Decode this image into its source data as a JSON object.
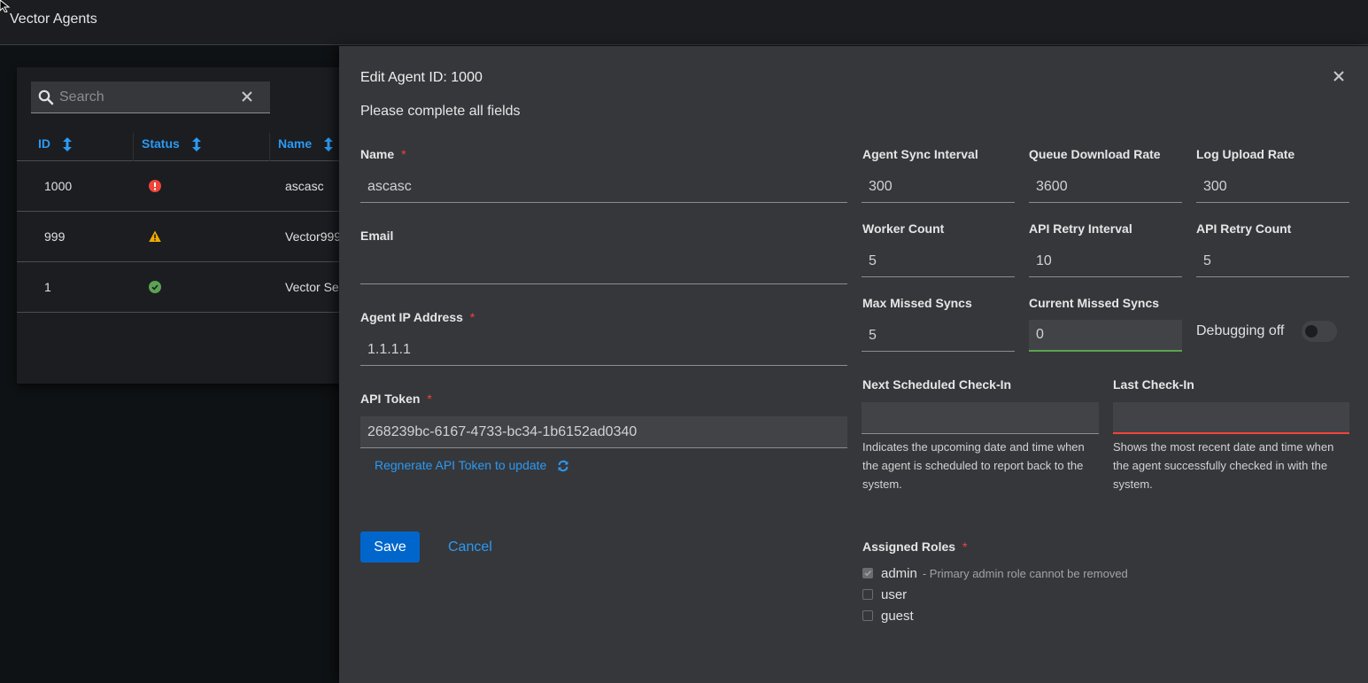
{
  "app": {
    "title": "Vector Agents"
  },
  "table": {
    "search": {
      "placeholder": "Search",
      "value": ""
    },
    "columns": [
      {
        "label": "ID"
      },
      {
        "label": "Status"
      },
      {
        "label": "Name"
      }
    ],
    "rows": [
      {
        "id": "1000",
        "status": "error",
        "name": "ascasc"
      },
      {
        "id": "999",
        "status": "warning",
        "name": "Vector999"
      },
      {
        "id": "1",
        "status": "success",
        "name": "Vector Se"
      }
    ],
    "status_colors": {
      "error": "#f0443a",
      "warning": "#f0ab00",
      "success": "#5ba352"
    }
  },
  "drawer": {
    "title": "Edit Agent ID: 1000",
    "subtitle": "Please complete all fields",
    "name": {
      "label": "Name",
      "required": "*",
      "value": "ascasc"
    },
    "email": {
      "label": "Email",
      "value": ""
    },
    "ip": {
      "label": "Agent IP Address",
      "required": "*",
      "value": "1.1.1.1"
    },
    "token": {
      "label": "API Token",
      "required": "*",
      "value": "268239bc-6167-4733-bc34-1b6152ad0340"
    },
    "regenerate_label": "Regnerate API Token to update",
    "save_label": "Save",
    "cancel_label": "Cancel",
    "settings": {
      "agent_sync_interval": {
        "label": "Agent Sync Interval",
        "value": "300"
      },
      "queue_download_rate": {
        "label": "Queue Download Rate",
        "value": "3600"
      },
      "log_upload_rate": {
        "label": "Log Upload Rate",
        "value": "300"
      },
      "worker_count": {
        "label": "Worker Count",
        "value": "5"
      },
      "api_retry_interval": {
        "label": "API Retry Interval",
        "value": "10"
      },
      "api_retry_count": {
        "label": "API Retry Count",
        "value": "5"
      },
      "max_missed_syncs": {
        "label": "Max Missed Syncs",
        "value": "5"
      },
      "current_missed_syncs": {
        "label": "Current Missed Syncs",
        "value": "0"
      }
    },
    "debugging": {
      "label": "Debugging off",
      "enabled": false
    },
    "next_checkin": {
      "label": "Next Scheduled Check-In",
      "value": "",
      "helper": "Indicates the upcoming date and time when the agent is scheduled to report back to the system."
    },
    "last_checkin": {
      "label": "Last Check-In",
      "value": "",
      "helper": "Shows the most recent date and time when the agent successfully checked in with the system."
    },
    "roles": {
      "label": "Assigned Roles",
      "required": "*",
      "items": [
        {
          "name": "admin",
          "checked": true,
          "note": "- Primary admin role cannot be removed"
        },
        {
          "name": "user",
          "checked": false,
          "note": ""
        },
        {
          "name": "guest",
          "checked": false,
          "note": ""
        }
      ]
    }
  }
}
